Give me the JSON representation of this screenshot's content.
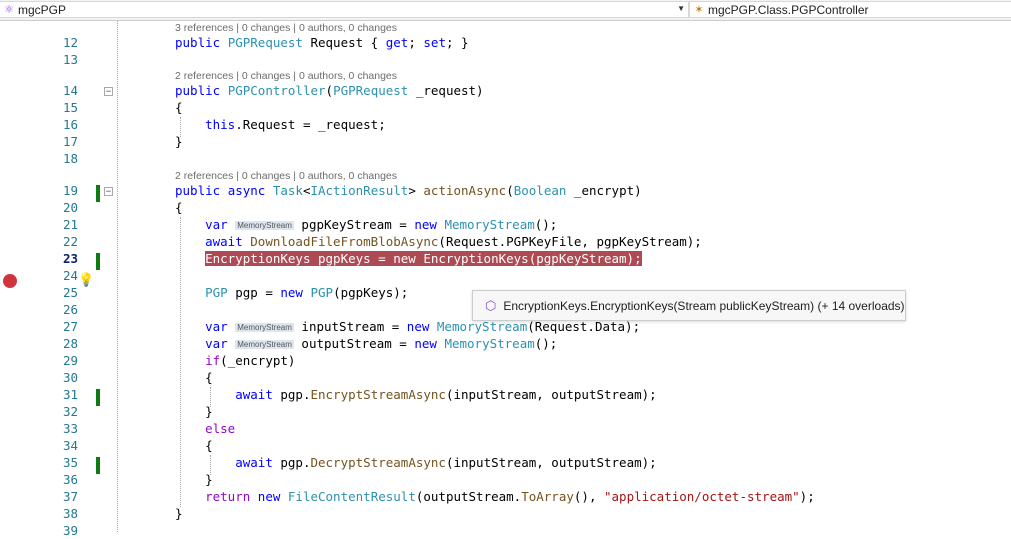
{
  "nav": {
    "project": "mgcPGP",
    "member": "mgcPGP.Class.PGPController",
    "project_icon": "project-icon",
    "member_icon": "class-icon"
  },
  "lenses": {
    "l12": "3 references | 0 changes | 0 authors, 0 changes",
    "l14": "2 references | 0 changes | 0 authors, 0 changes",
    "l19": "2 references | 0 changes | 0 authors, 0 changes"
  },
  "lines": [
    {
      "n": "12"
    },
    {
      "n": "13"
    },
    {
      "n": "14"
    },
    {
      "n": "15"
    },
    {
      "n": "16"
    },
    {
      "n": "17"
    },
    {
      "n": "18"
    },
    {
      "n": "19"
    },
    {
      "n": "20"
    },
    {
      "n": "21"
    },
    {
      "n": "22"
    },
    {
      "n": "23"
    },
    {
      "n": "24"
    },
    {
      "n": "25"
    },
    {
      "n": "26"
    },
    {
      "n": "27"
    },
    {
      "n": "28"
    },
    {
      "n": "29"
    },
    {
      "n": "30"
    },
    {
      "n": "31"
    },
    {
      "n": "32"
    },
    {
      "n": "33"
    },
    {
      "n": "34"
    },
    {
      "n": "35"
    },
    {
      "n": "36"
    },
    {
      "n": "37"
    },
    {
      "n": "38"
    },
    {
      "n": "39"
    }
  ],
  "code": {
    "l12": [
      [
        "public ",
        "k"
      ],
      [
        "PGPRequest",
        "t"
      ],
      [
        " Request { ",
        ""
      ],
      [
        "get",
        "k"
      ],
      [
        "; ",
        ""
      ],
      [
        "set",
        "k"
      ],
      [
        "; }",
        ""
      ]
    ],
    "l14": [
      [
        "public ",
        "k"
      ],
      [
        "PGPController",
        "t"
      ],
      [
        "(",
        ""
      ],
      [
        "PGPRequest",
        "t"
      ],
      [
        " _request)",
        ""
      ]
    ],
    "l15": [
      [
        "{",
        ""
      ]
    ],
    "l16": [
      [
        "    ",
        ""
      ],
      [
        "this",
        "k"
      ],
      [
        ".Request = _request;",
        ""
      ]
    ],
    "l17": [
      [
        "}",
        ""
      ]
    ],
    "l19": [
      [
        "public ",
        "k"
      ],
      [
        "async ",
        "k"
      ],
      [
        "Task",
        "t"
      ],
      [
        "<",
        ""
      ],
      [
        "IActionResult",
        "t"
      ],
      [
        "> ",
        ""
      ],
      [
        "actionAsync",
        "m"
      ],
      [
        "(",
        ""
      ],
      [
        "Boolean",
        "t"
      ],
      [
        " _encrypt)",
        ""
      ]
    ],
    "l20": [
      [
        "{",
        ""
      ]
    ],
    "l21": [
      [
        "    ",
        ""
      ],
      [
        "var ",
        "k"
      ],
      [
        "MemoryStream",
        "hint"
      ],
      [
        " pgpKeyStream = ",
        ""
      ],
      [
        "new ",
        "k"
      ],
      [
        "MemoryStream",
        "t"
      ],
      [
        "();",
        ""
      ]
    ],
    "l22": [
      [
        "    ",
        ""
      ],
      [
        "await ",
        "k"
      ],
      [
        "DownloadFileFromBlobAsync",
        "m"
      ],
      [
        "(Request.PGPKeyFile, pgpKeyStream);",
        ""
      ]
    ],
    "l23": [
      [
        "    ",
        ""
      ],
      [
        "EncryptionKeys pgpKeys = new EncryptionKeys(pgpKeyStream);",
        "hl"
      ]
    ],
    "l25": [
      [
        "    ",
        ""
      ],
      [
        "PGP",
        "t"
      ],
      [
        " pgp = ",
        ""
      ],
      [
        "new ",
        "k"
      ],
      [
        "PGP",
        "t"
      ],
      [
        "(pgpKeys);",
        ""
      ]
    ],
    "l27": [
      [
        "    ",
        ""
      ],
      [
        "var ",
        "k"
      ],
      [
        "MemoryStream",
        "hint"
      ],
      [
        " inputStream = ",
        ""
      ],
      [
        "new ",
        "k"
      ],
      [
        "MemoryStream",
        "t"
      ],
      [
        "(Request.Data);",
        ""
      ]
    ],
    "l28": [
      [
        "    ",
        ""
      ],
      [
        "var ",
        "k"
      ],
      [
        "MemoryStream",
        "hint"
      ],
      [
        " outputStream = ",
        ""
      ],
      [
        "new ",
        "k"
      ],
      [
        "MemoryStream",
        "t"
      ],
      [
        "();",
        ""
      ]
    ],
    "l29": [
      [
        "    ",
        ""
      ],
      [
        "if",
        "c"
      ],
      [
        "(_encrypt)",
        ""
      ]
    ],
    "l30": [
      [
        "    {",
        ""
      ]
    ],
    "l31": [
      [
        "        ",
        ""
      ],
      [
        "await ",
        "k"
      ],
      [
        "pgp.",
        ""
      ],
      [
        "EncryptStreamAsync",
        "m"
      ],
      [
        "(inputStream, outputStream);",
        ""
      ]
    ],
    "l32": [
      [
        "    }",
        ""
      ]
    ],
    "l33": [
      [
        "    ",
        ""
      ],
      [
        "else",
        "c"
      ]
    ],
    "l34": [
      [
        "    {",
        ""
      ]
    ],
    "l35": [
      [
        "        ",
        ""
      ],
      [
        "await ",
        "k"
      ],
      [
        "pgp.",
        ""
      ],
      [
        "DecryptStreamAsync",
        "m"
      ],
      [
        "(inputStream, outputStream);",
        ""
      ]
    ],
    "l36": [
      [
        "    }",
        ""
      ]
    ],
    "l37": [
      [
        "    ",
        ""
      ],
      [
        "return ",
        "c"
      ],
      [
        "new ",
        "k"
      ],
      [
        "FileContentResult",
        "t"
      ],
      [
        "(outputStream.",
        ""
      ],
      [
        "ToArray",
        "m"
      ],
      [
        "(), ",
        ""
      ],
      [
        "\"application/octet-stream\"",
        "s"
      ],
      [
        ");",
        ""
      ]
    ],
    "l38": [
      [
        "}",
        ""
      ]
    ]
  },
  "tooltip": {
    "text": "EncryptionKeys.EncryptionKeys(Stream publicKeyStream) (+ 14 overloads)",
    "icon": "method-icon"
  },
  "gutter": {
    "breakpoint_icon": "breakpoint-icon",
    "lightbulb_icon": "lightbulb-icon"
  },
  "colors": {
    "keyword": "#0000ff",
    "type": "#2b91af",
    "method": "#74531f",
    "string": "#a31515",
    "control": "#8f08c4",
    "highlight": "#ae4a54",
    "breakpoint": "#d1343e",
    "change_bar": "#107c10"
  }
}
